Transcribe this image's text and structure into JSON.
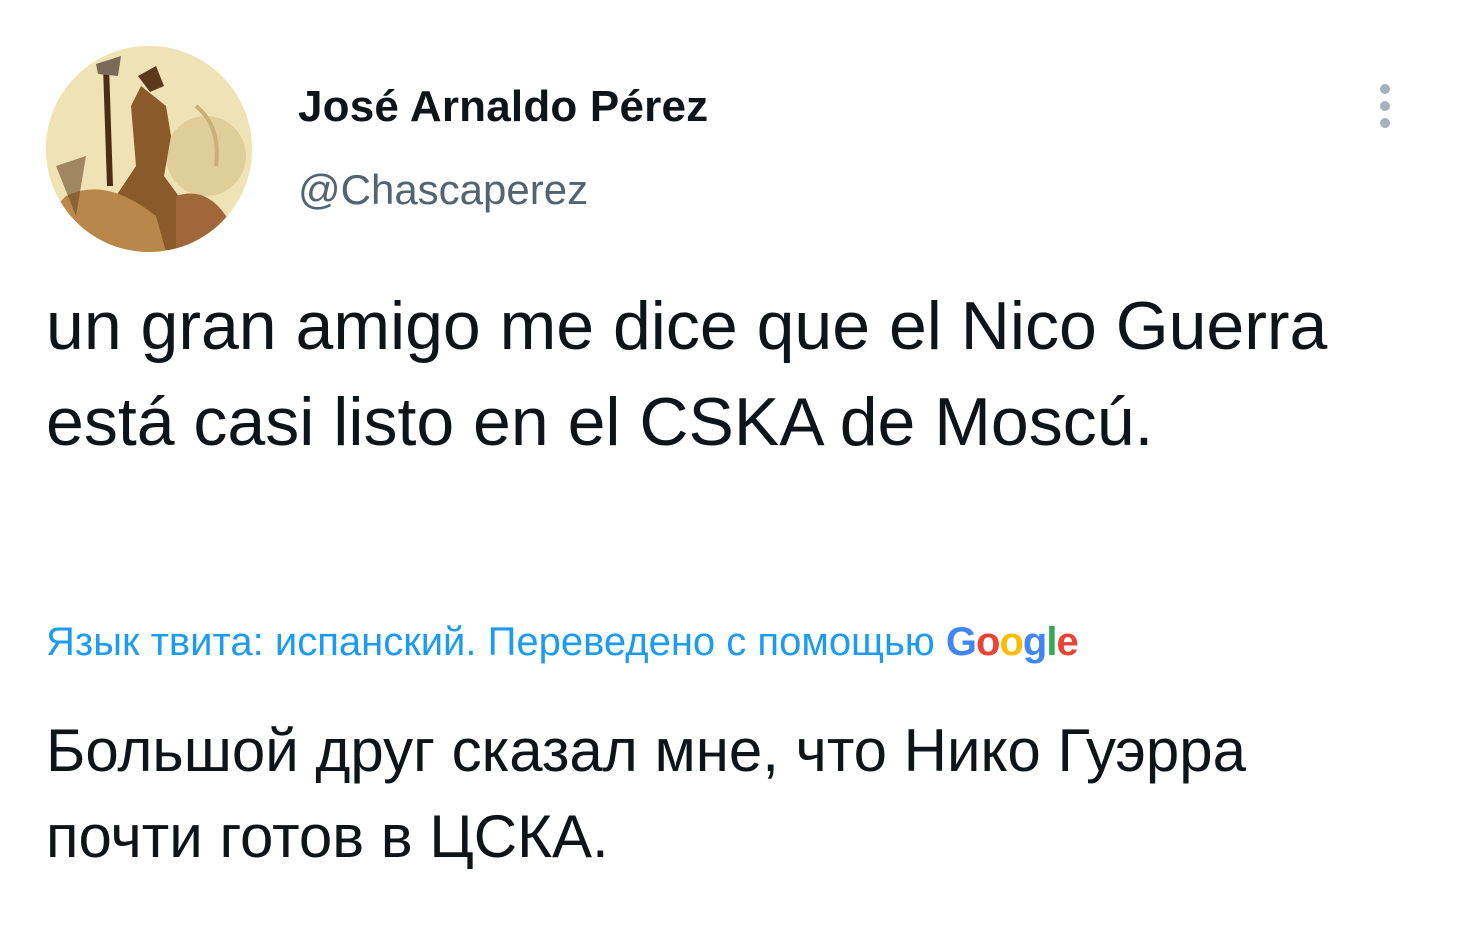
{
  "tweet": {
    "author": {
      "display_name": "José Arnaldo Pérez",
      "handle": "@Chascaperez"
    },
    "text": "un gran amigo me dice que el Nico Guerra está casi listo en el CSKA de Moscú.",
    "translation": {
      "notice": "Язык твита: испанский. Переведено с помощью ",
      "provider_letters": [
        "G",
        "o",
        "o",
        "g",
        "l",
        "e"
      ],
      "text": "Большой друг сказал мне, что Нико Гуэрра почти готов в ЦСКА."
    }
  },
  "icons": {
    "more": "more-vertical-icon",
    "avatar": "user-avatar-image"
  },
  "colors": {
    "text_primary": "#0f1419",
    "text_secondary": "#536471",
    "link": "#1d9bf0",
    "google_blue": "#4285f4",
    "google_red": "#ea4335",
    "google_yellow": "#fbbc05",
    "google_green": "#34a853"
  }
}
